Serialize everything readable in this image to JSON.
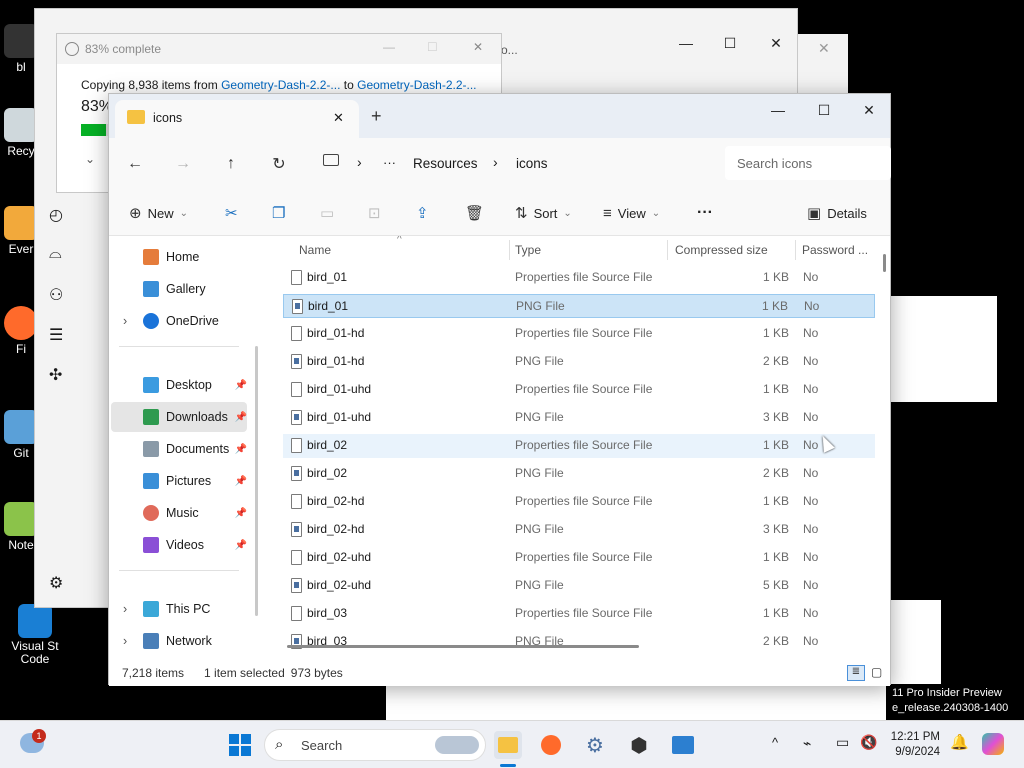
{
  "desktop": {
    "icons": [
      {
        "label": "bl"
      },
      {
        "label": "Recy"
      },
      {
        "label": "Ever"
      },
      {
        "label": "Fi"
      },
      {
        "label": "Git"
      },
      {
        "label": "Note"
      },
      {
        "label": "Visual St Code"
      }
    ],
    "watermark_line1": "11 Pro Insider Preview",
    "watermark_line2": "e_release.240308-1400"
  },
  "bg_windows": {
    "folder_fragment": "o..."
  },
  "copy_dialog": {
    "title": "83% complete",
    "line_prefix": "Copying 8,938 items from ",
    "source": "Geometry-Dash-2.2-...",
    "line_mid": " to ",
    "dest": "Geometry-Dash-2.2-...",
    "percent": "83%",
    "progress": 0.83
  },
  "explorer": {
    "tab_title": "icons",
    "breadcrumb": {
      "more": "···",
      "parent": "Resources",
      "current": "icons"
    },
    "search_placeholder": "Search icons",
    "toolbar": {
      "new": "New",
      "sort": "Sort",
      "view": "View",
      "more": "···",
      "details": "Details"
    },
    "sidebar": [
      {
        "label": "Home"
      },
      {
        "label": "Gallery"
      },
      {
        "label": "OneDrive"
      },
      {
        "label": "Desktop"
      },
      {
        "label": "Downloads"
      },
      {
        "label": "Documents"
      },
      {
        "label": "Pictures"
      },
      {
        "label": "Music"
      },
      {
        "label": "Videos"
      },
      {
        "label": "This PC"
      },
      {
        "label": "Network"
      }
    ],
    "columns": {
      "name": "Name",
      "type": "Type",
      "size": "Compressed size",
      "password": "Password ..."
    },
    "files": [
      {
        "name": "bird_01",
        "type": "Properties file Source File",
        "size": "1 KB",
        "password": "No",
        "kind": "props"
      },
      {
        "name": "bird_01",
        "type": "PNG File",
        "size": "1 KB",
        "password": "No",
        "kind": "png"
      },
      {
        "name": "bird_01-hd",
        "type": "Properties file Source File",
        "size": "1 KB",
        "password": "No",
        "kind": "props"
      },
      {
        "name": "bird_01-hd",
        "type": "PNG File",
        "size": "2 KB",
        "password": "No",
        "kind": "png"
      },
      {
        "name": "bird_01-uhd",
        "type": "Properties file Source File",
        "size": "1 KB",
        "password": "No",
        "kind": "props"
      },
      {
        "name": "bird_01-uhd",
        "type": "PNG File",
        "size": "3 KB",
        "password": "No",
        "kind": "png"
      },
      {
        "name": "bird_02",
        "type": "Properties file Source File",
        "size": "1 KB",
        "password": "No",
        "kind": "props"
      },
      {
        "name": "bird_02",
        "type": "PNG File",
        "size": "2 KB",
        "password": "No",
        "kind": "png"
      },
      {
        "name": "bird_02-hd",
        "type": "Properties file Source File",
        "size": "1 KB",
        "password": "No",
        "kind": "props"
      },
      {
        "name": "bird_02-hd",
        "type": "PNG File",
        "size": "3 KB",
        "password": "No",
        "kind": "png"
      },
      {
        "name": "bird_02-uhd",
        "type": "Properties file Source File",
        "size": "1 KB",
        "password": "No",
        "kind": "props"
      },
      {
        "name": "bird_02-uhd",
        "type": "PNG File",
        "size": "5 KB",
        "password": "No",
        "kind": "png"
      },
      {
        "name": "bird_03",
        "type": "Properties file Source File",
        "size": "1 KB",
        "password": "No",
        "kind": "props"
      },
      {
        "name": "bird_03",
        "type": "PNG File",
        "size": "2 KB",
        "password": "No",
        "kind": "png"
      }
    ],
    "status": {
      "count": "7,218 items",
      "selection": "1 item selected",
      "bytes": "973 bytes"
    }
  },
  "taskbar": {
    "search_label": "Search",
    "notification_badge": "1",
    "time": "12:21 PM",
    "date": "9/9/2024"
  },
  "colors": {
    "accent": "#0067c0",
    "selected_row": "#cce4f7",
    "progress": "#06b025"
  }
}
